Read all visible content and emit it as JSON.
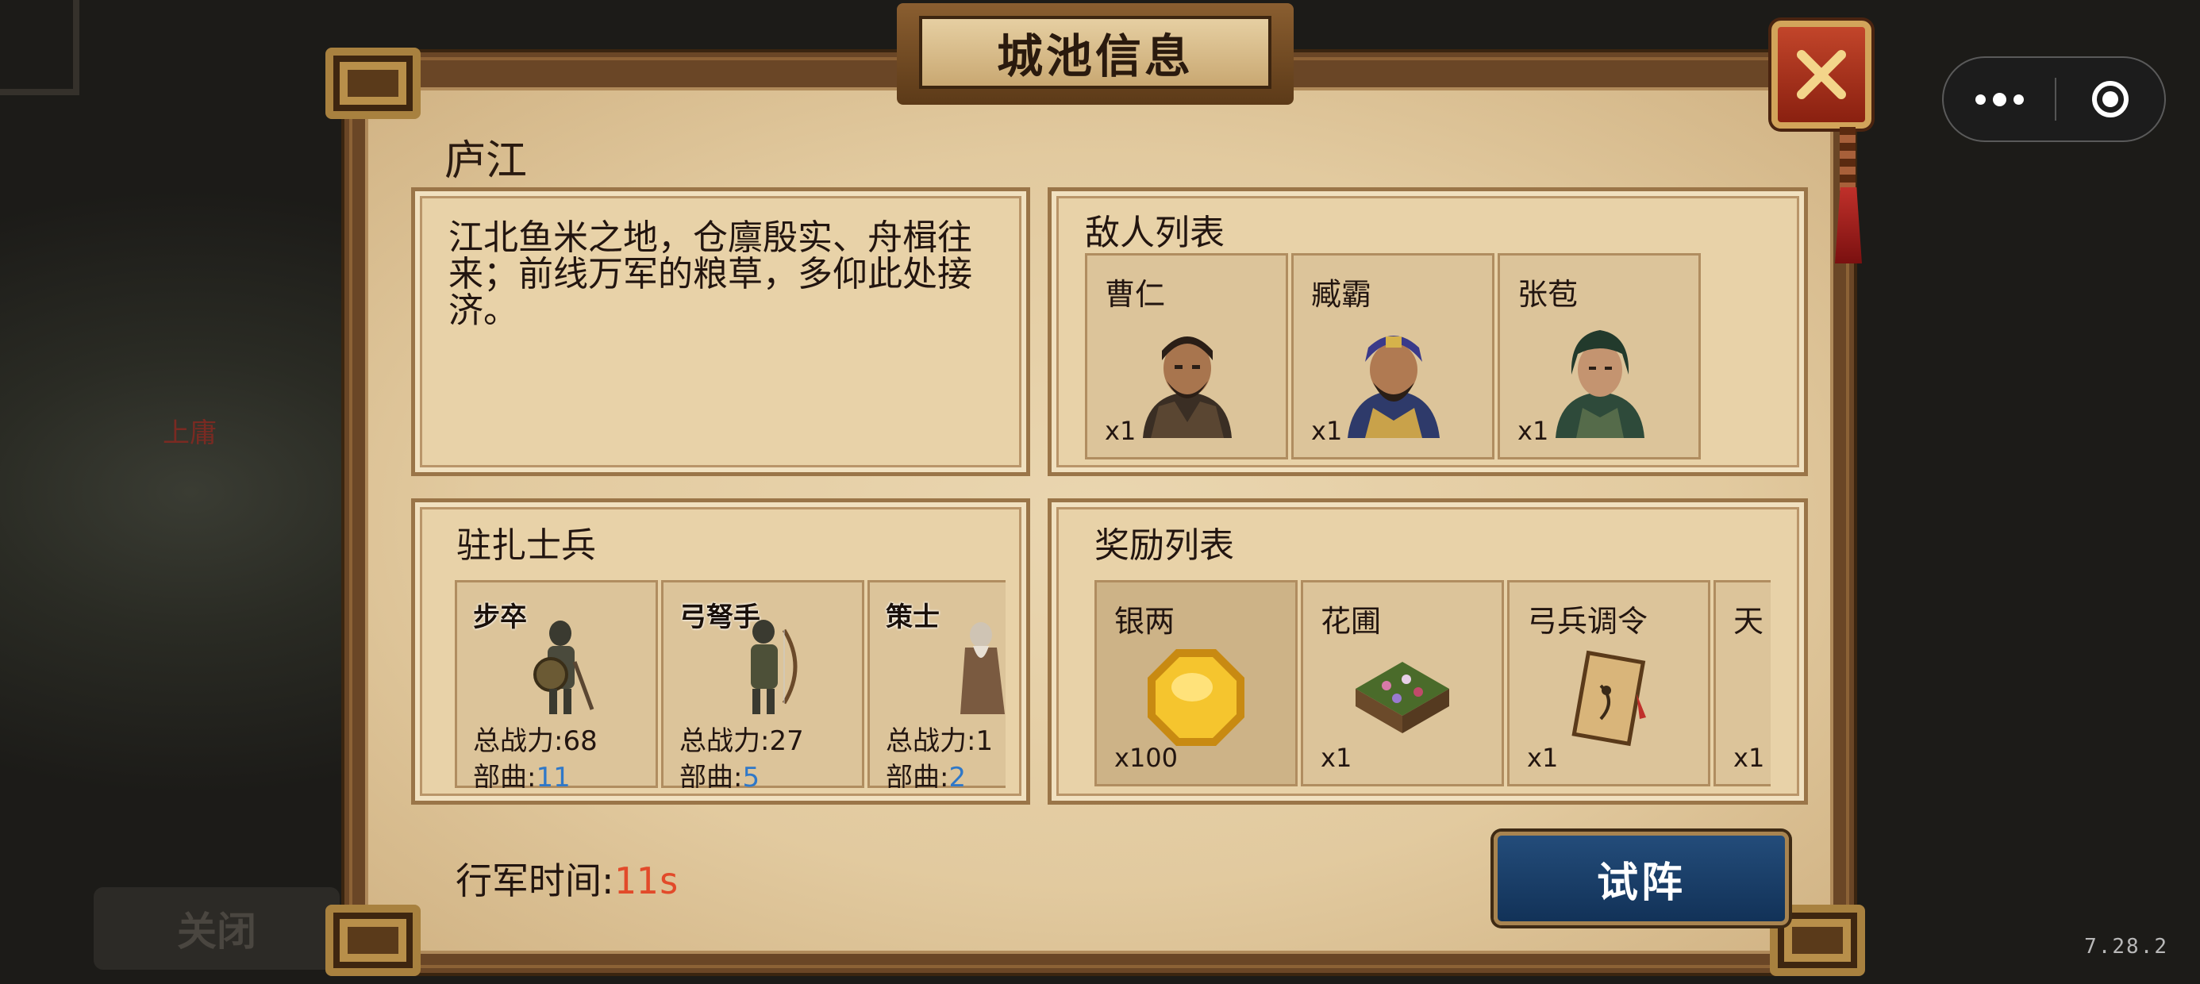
{
  "background": {
    "city_label": "上庸",
    "close_label": "关闭"
  },
  "capsule": {
    "more_icon": "more-dots-icon",
    "target_icon": "target-icon"
  },
  "version": "7.28.2",
  "dialog": {
    "title": "城池信息",
    "city_name": "庐江",
    "description": "江北鱼米之地，仓廪殷实、舟楫往来；前线万军的粮草，多仰此处接济。",
    "enemy_panel": {
      "title": "敌人列表",
      "enemies": [
        {
          "name": "曹仁",
          "count": "x1",
          "color": "#4a3a2a"
        },
        {
          "name": "臧霸",
          "count": "x1",
          "color": "#2e3a6a"
        },
        {
          "name": "张苞",
          "count": "x1",
          "color": "#2e4a3a"
        }
      ]
    },
    "troop_panel": {
      "title": "驻扎士兵",
      "power_label": "总战力:",
      "bu_label": "部曲:",
      "troops": [
        {
          "name": "步卒",
          "power": "68",
          "bu": "11"
        },
        {
          "name": "弓弩手",
          "power": "27",
          "bu": "5"
        },
        {
          "name": "策士",
          "power": "1",
          "bu": "2"
        }
      ]
    },
    "reward_panel": {
      "title": "奖励列表",
      "rewards": [
        {
          "name": "银两",
          "count": "x100",
          "icon": "silver-coin-icon"
        },
        {
          "name": "花圃",
          "count": "x1",
          "icon": "flower-bed-icon"
        },
        {
          "name": "弓兵调令",
          "count": "x1",
          "icon": "archer-scroll-icon"
        },
        {
          "name": "天",
          "count": "x1",
          "icon": "reward-icon"
        }
      ]
    },
    "march_label": "行军时间:",
    "march_value": "11s",
    "trial_button": "试阵",
    "close_icon": "close-icon"
  },
  "colors": {
    "accent_blue": "#2f78c8",
    "march_red": "#e24a2a",
    "button_blue": "#234c7a"
  }
}
